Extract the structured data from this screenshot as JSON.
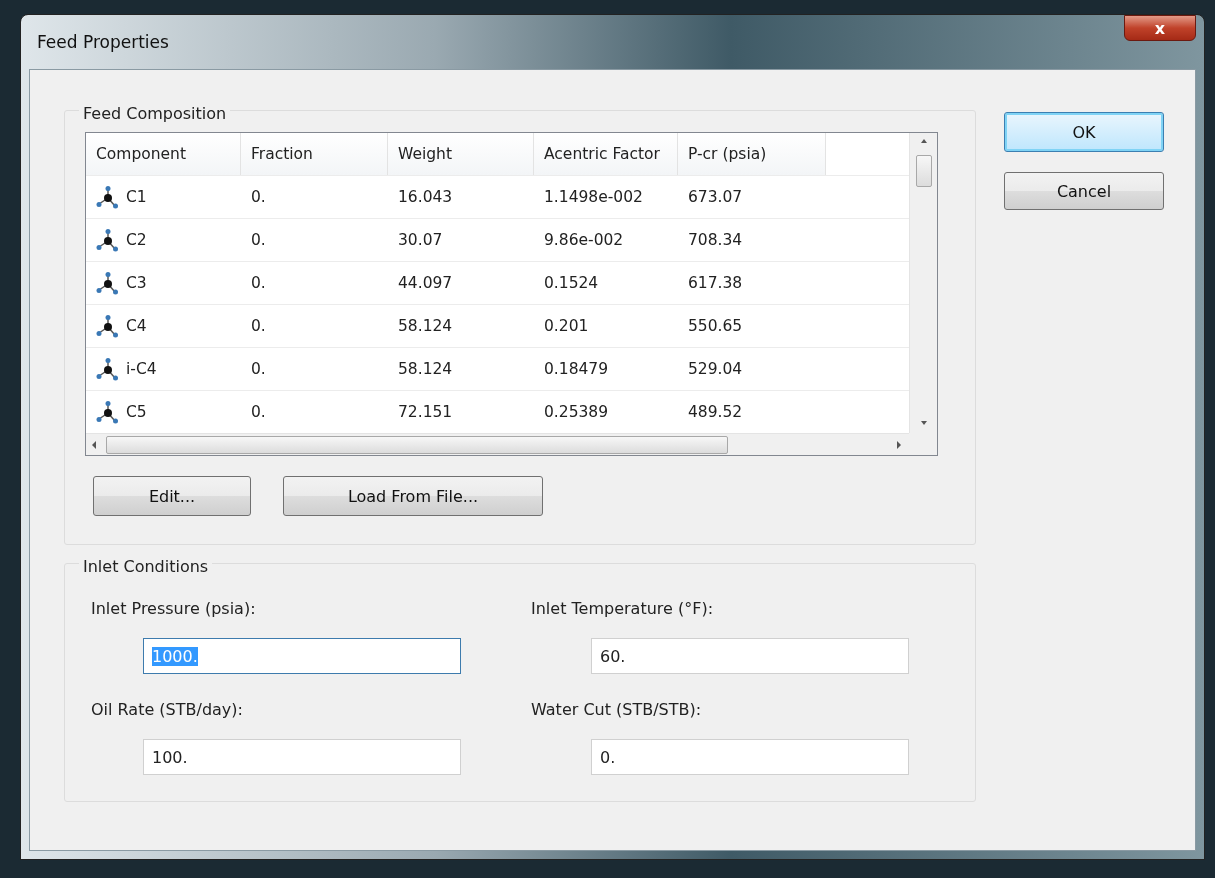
{
  "window": {
    "title": "Feed Properties",
    "close": "x"
  },
  "feed_composition": {
    "title": "Feed Composition",
    "table": {
      "columns": [
        "Component",
        "Fraction",
        "Weight",
        "Acentric Factor",
        "P-cr (psia)"
      ],
      "rows": [
        {
          "cells": [
            "C1",
            "0.",
            "16.043",
            "1.1498e-002",
            "673.07"
          ]
        },
        {
          "cells": [
            "C2",
            "0.",
            "30.07",
            "9.86e-002",
            "708.34"
          ]
        },
        {
          "cells": [
            "C3",
            "0.",
            "44.097",
            "0.1524",
            "617.38"
          ]
        },
        {
          "cells": [
            "C4",
            "0.",
            "58.124",
            "0.201",
            "550.65"
          ]
        },
        {
          "cells": [
            "i-C4",
            "0.",
            "58.124",
            "0.18479",
            "529.04"
          ]
        },
        {
          "cells": [
            "C5",
            "0.",
            "72.151",
            "0.25389",
            "489.52"
          ]
        }
      ]
    },
    "buttons": [
      "Edit...",
      "Load From File..."
    ]
  },
  "inlet_conditions": {
    "title": "Inlet Conditions",
    "fields": [
      {
        "label": "Inlet Pressure (psia):",
        "value": "1000.",
        "text_selected": true
      },
      {
        "label": "Inlet Temperature (°F):",
        "value": "60.",
        "text_selected": false
      },
      {
        "label": "Oil Rate (STB/day):",
        "value": "100.",
        "text_selected": false
      },
      {
        "label": "Water Cut (STB/STB):",
        "value": "0.",
        "text_selected": false
      }
    ]
  },
  "dialog_buttons": [
    {
      "label": "OK",
      "default": true
    },
    {
      "label": "Cancel",
      "default": false
    }
  ]
}
